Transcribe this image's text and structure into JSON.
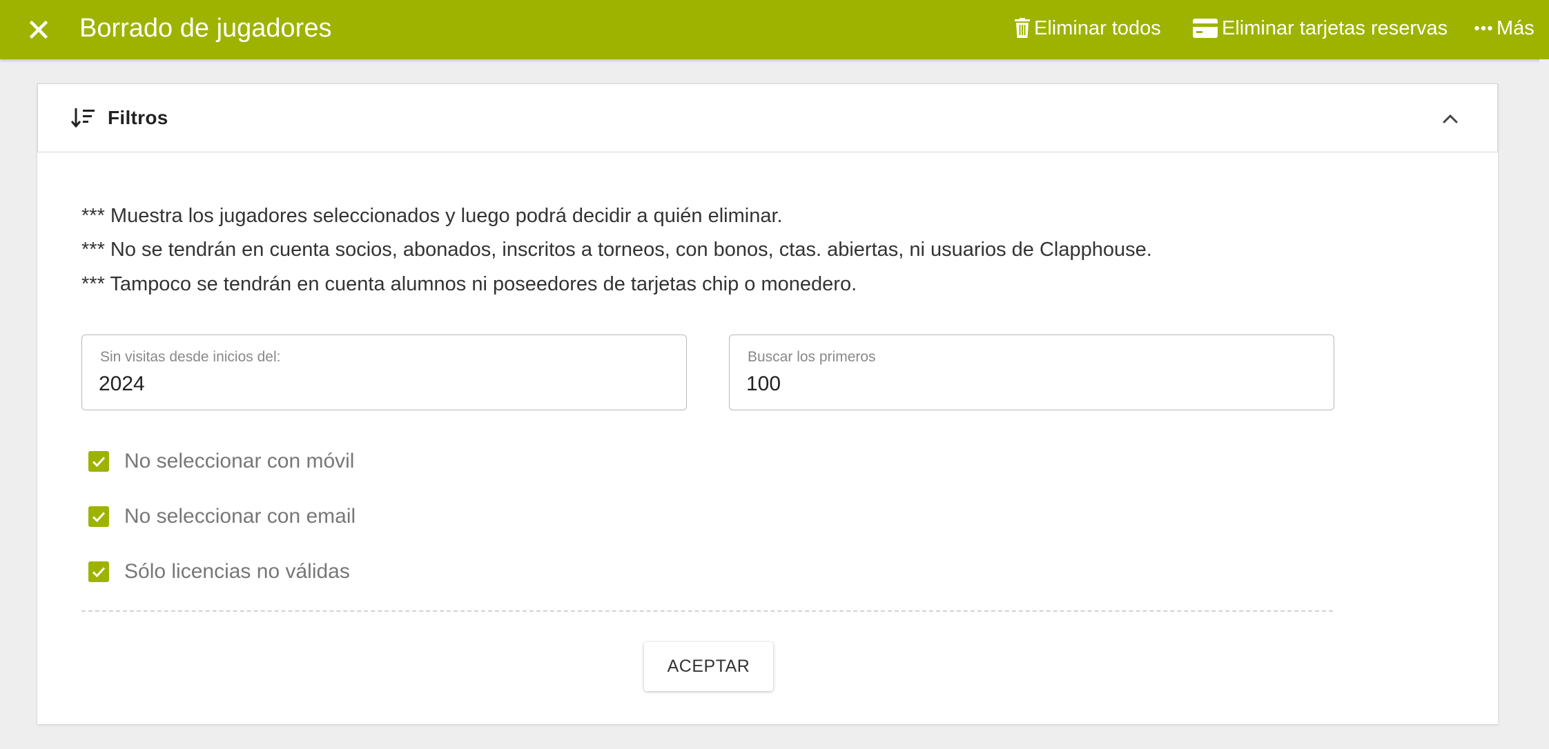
{
  "header": {
    "title": "Borrado de jugadores",
    "close_icon": "close-icon",
    "actions": [
      {
        "label": "Eliminar todos",
        "icon": "trash-icon"
      },
      {
        "label": "Eliminar tarjetas reservas",
        "icon": "card-icon"
      },
      {
        "label": "Más",
        "icon": "more-icon"
      }
    ]
  },
  "filters": {
    "title": "Filtros",
    "icon": "sort-filter-icon",
    "collapse_icon": "chevron-up-icon",
    "notes": [
      "*** Muestra los jugadores seleccionados y luego podrá decidir a quién eliminar.",
      "*** No se tendrán en cuenta socios, abonados, inscritos a torneos, con bonos, ctas. abiertas, ni usuarios de Clapphouse.",
      "*** Tampoco se tendrán en cuenta alumnos ni poseedores de tarjetas chip o monedero."
    ],
    "fields": [
      {
        "label": "Sin visitas desde inicios del:",
        "value": "2024"
      },
      {
        "label": "Buscar los primeros",
        "value": "100"
      }
    ],
    "checkboxes": [
      {
        "label": "No seleccionar con móvil",
        "checked": true
      },
      {
        "label": "No seleccionar con email",
        "checked": true
      },
      {
        "label": "Sólo licencias no válidas",
        "checked": true
      }
    ],
    "accept_label": "ACEPTAR"
  },
  "colors": {
    "accent": "#9db300",
    "background": "#eeeeee",
    "card": "#ffffff"
  }
}
